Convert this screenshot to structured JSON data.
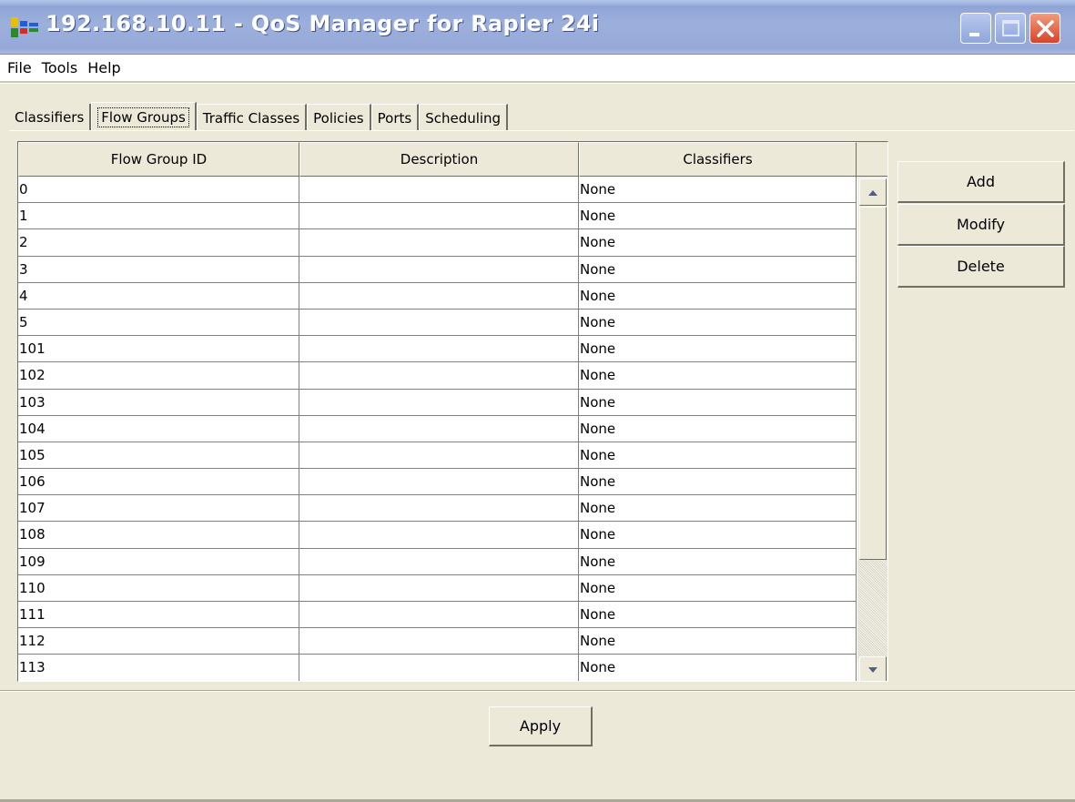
{
  "window": {
    "title": "192.168.10.11 - QoS Manager for Rapier 24i",
    "icon": "app-icon"
  },
  "menu": [
    "File",
    "Tools",
    "Help"
  ],
  "tabs": [
    {
      "label": "Classifiers",
      "active": false
    },
    {
      "label": "Flow Groups",
      "active": true
    },
    {
      "label": "Traffic Classes",
      "active": false
    },
    {
      "label": "Policies",
      "active": false
    },
    {
      "label": "Ports",
      "active": false
    },
    {
      "label": "Scheduling",
      "active": false
    }
  ],
  "table": {
    "columns": [
      "Flow Group ID",
      "Description",
      "Classifiers"
    ],
    "rows": [
      [
        "0",
        "",
        "None"
      ],
      [
        "1",
        "",
        "None"
      ],
      [
        "2",
        "",
        "None"
      ],
      [
        "3",
        "",
        "None"
      ],
      [
        "4",
        "",
        "None"
      ],
      [
        "5",
        "",
        "None"
      ],
      [
        "101",
        "",
        "None"
      ],
      [
        "102",
        "",
        "None"
      ],
      [
        "103",
        "",
        "None"
      ],
      [
        "104",
        "",
        "None"
      ],
      [
        "105",
        "",
        "None"
      ],
      [
        "106",
        "",
        "None"
      ],
      [
        "107",
        "",
        "None"
      ],
      [
        "108",
        "",
        "None"
      ],
      [
        "109",
        "",
        "None"
      ],
      [
        "110",
        "",
        "None"
      ],
      [
        "111",
        "",
        "None"
      ],
      [
        "112",
        "",
        "None"
      ],
      [
        "113",
        "",
        "None"
      ]
    ]
  },
  "actions": {
    "add": "Add",
    "modify": "Modify",
    "delete": "Delete",
    "apply": "Apply"
  },
  "colors": {
    "titlebar": "#9db0dc",
    "face": "#ece9d8",
    "close": "#d8432b"
  }
}
